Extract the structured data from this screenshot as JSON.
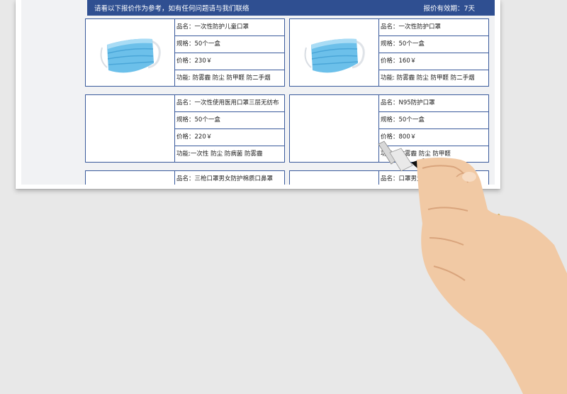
{
  "banner": {
    "notice": "请看以下报价作为参考，如有任何问题请与我们联络",
    "validity": "报价有效期：7天"
  },
  "products": [
    {
      "name": "品名：一次性防护儿童口罩",
      "spec": "规格：50个一盒",
      "price": "价格：230￥",
      "func": "功能: 防雾霾 防尘 防甲醛 防二手烟",
      "image": "mask-icon"
    },
    {
      "name": "品名：一次性防护口罩",
      "spec": "规格：50个一盒",
      "price": "价格：160￥",
      "func": "功能: 防雾霾 防尘 防甲醛 防二手烟",
      "image": "mask-icon"
    },
    {
      "name": "品名：一次性使用医用口罩三层无纺布",
      "spec": "规格：50个一盒",
      "price": "价格：220￥",
      "func": "功能:一次性 防尘 防病菌 防雾霾"
    },
    {
      "name": "品名：N95防护口罩",
      "spec": "规格：50个一盒",
      "price": "价格：800￥",
      "func": "功能：防雾霾 防尘 防甲醛"
    },
    {
      "name": "品名：三枪口罩男女防护棉质口鼻罩"
    },
    {
      "name": "品名：口罩男女防尘"
    }
  ],
  "colors": {
    "banner": "#2f4f91",
    "border": "#3a5a9c"
  }
}
